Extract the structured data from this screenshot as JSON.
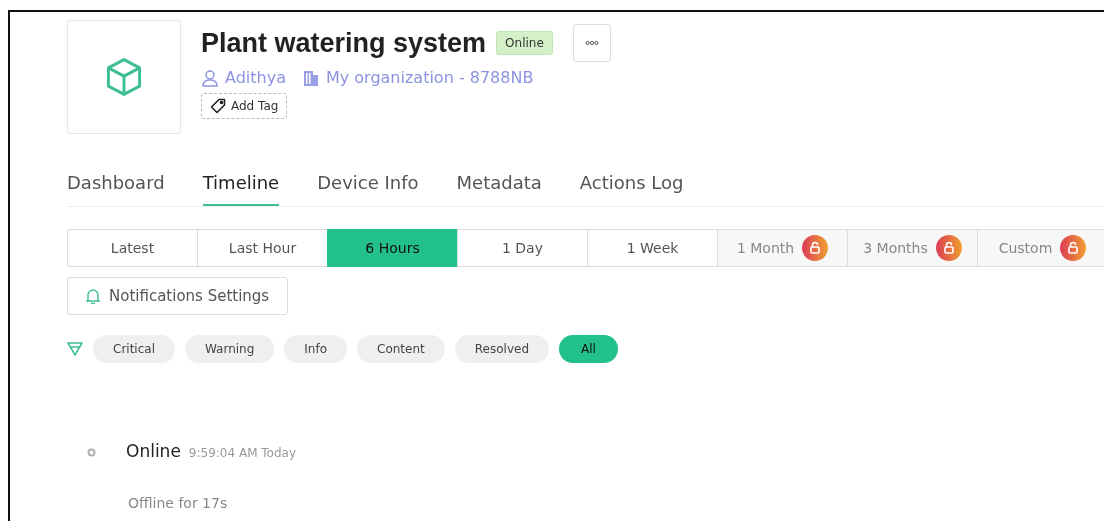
{
  "device": {
    "name": "Plant watering system",
    "status": "Online",
    "owner": "Adithya",
    "organization": "My organization - 8788NB",
    "add_tag": "Add Tag"
  },
  "tabs": [
    {
      "label": "Dashboard",
      "selected": false
    },
    {
      "label": "Timeline",
      "selected": true
    },
    {
      "label": "Device Info",
      "selected": false
    },
    {
      "label": "Metadata",
      "selected": false
    },
    {
      "label": "Actions Log",
      "selected": false
    }
  ],
  "ranges": [
    {
      "label": "Latest",
      "selected": false,
      "locked": false
    },
    {
      "label": "Last Hour",
      "selected": false,
      "locked": false
    },
    {
      "label": "6 Hours",
      "selected": true,
      "locked": false
    },
    {
      "label": "1 Day",
      "selected": false,
      "locked": false
    },
    {
      "label": "1 Week",
      "selected": false,
      "locked": false
    },
    {
      "label": "1 Month",
      "selected": false,
      "locked": true
    },
    {
      "label": "3 Months",
      "selected": false,
      "locked": true
    },
    {
      "label": "Custom",
      "selected": false,
      "locked": true
    }
  ],
  "notifications_button": "Notifications Settings",
  "filters": [
    {
      "label": "Critical",
      "selected": false
    },
    {
      "label": "Warning",
      "selected": false
    },
    {
      "label": "Info",
      "selected": false
    },
    {
      "label": "Content",
      "selected": false
    },
    {
      "label": "Resolved",
      "selected": false
    },
    {
      "label": "All",
      "selected": true
    }
  ],
  "events": [
    {
      "title": "Online",
      "time": "9:59:04 AM Today",
      "detail": "Offline for 17s"
    }
  ]
}
